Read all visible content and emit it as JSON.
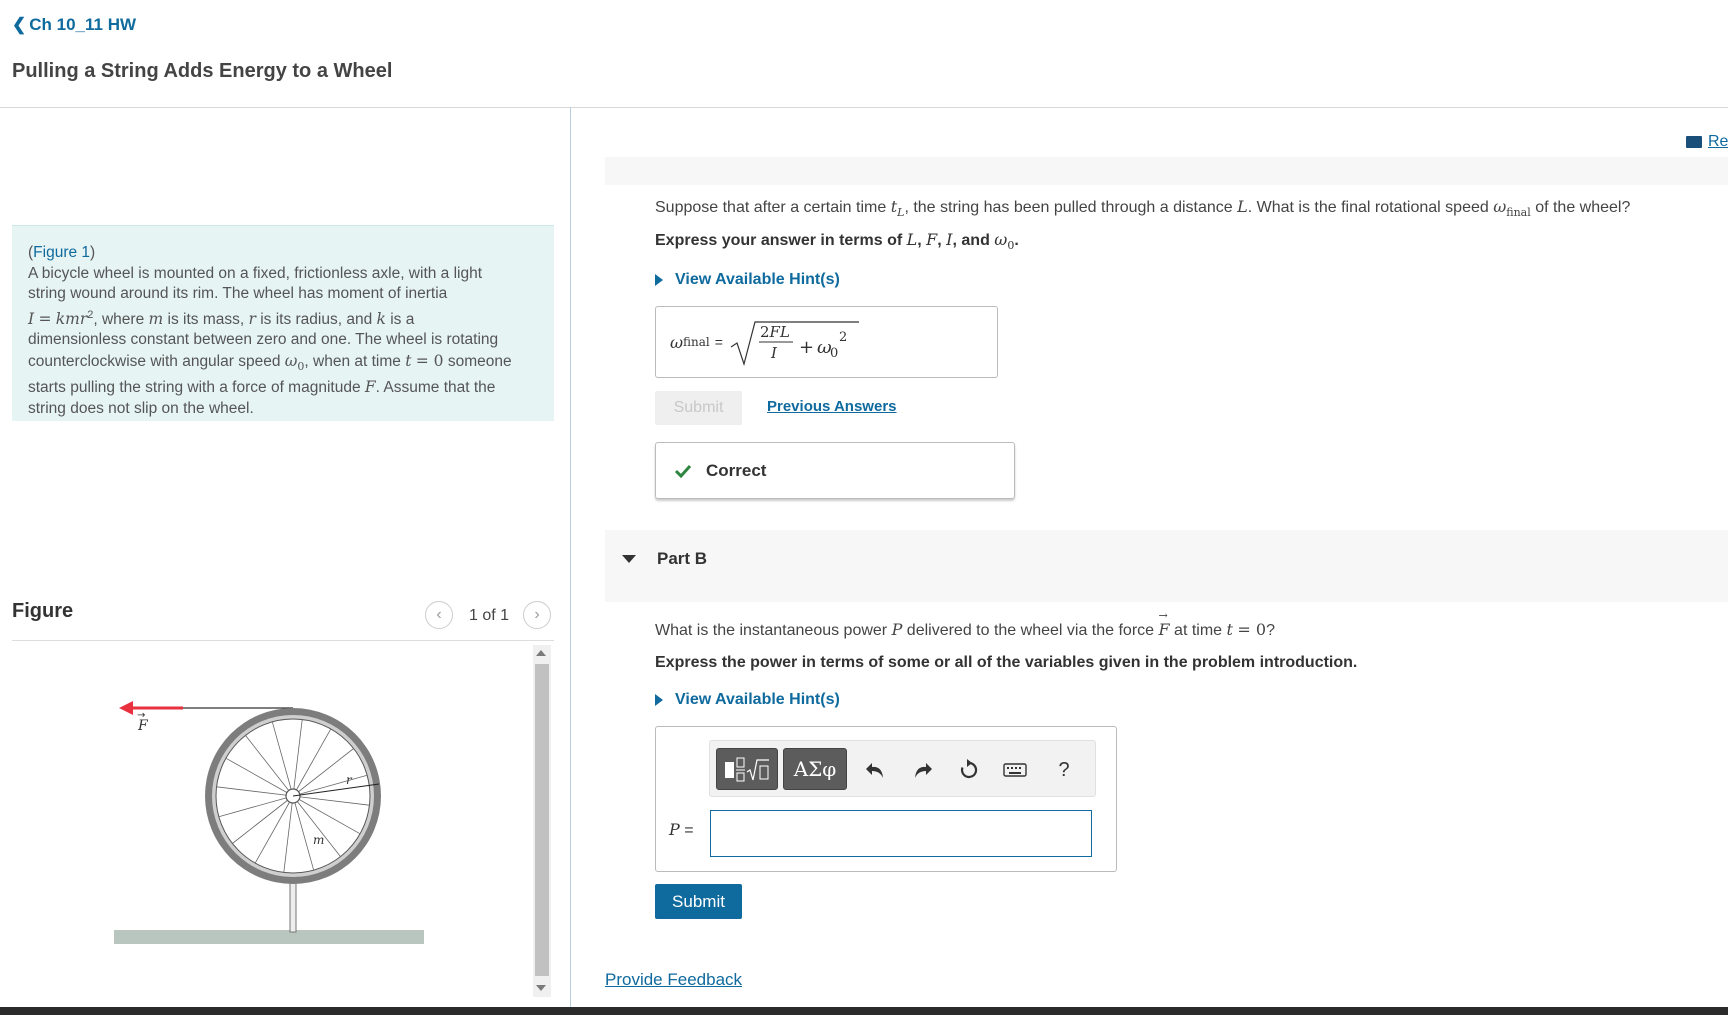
{
  "header": {
    "back_label": "Ch 10_11 HW",
    "page_title": "Pulling a String Adds Energy to a Wheel"
  },
  "intro": {
    "figure_link": "Figure 1",
    "line1": "A bicycle wheel is mounted on a fixed, frictionless axle, with a light",
    "line2": "string wound around its rim. The wheel has moment of inertia"
  },
  "figure": {
    "heading": "Figure",
    "pager": "1 of 1",
    "labels": {
      "force": "F",
      "radius": "r",
      "mass": "m"
    }
  },
  "review": {
    "label": "Re"
  },
  "part_a": {
    "express": "Express your answer in terms of",
    "hints": "View Available Hint(s)",
    "answer_lhs": "final",
    "submit": "Submit",
    "previous_answers": "Previous Answers",
    "status": "Correct"
  },
  "part_b": {
    "label": "Part B",
    "express": "Express the power in terms of some or all of the variables given in the problem introduction.",
    "hints": "View Available Hint(s)",
    "variable": "P",
    "submit": "Submit"
  },
  "feedback": {
    "label": "Provide Feedback"
  },
  "icons": {
    "back": "chevron-left-icon",
    "review": "book-icon",
    "hint": "triangle-right-icon",
    "correct": "check-icon",
    "collapse": "triangle-down-icon",
    "undo": "undo-icon",
    "redo": "redo-icon",
    "reset": "reset-icon",
    "keyboard": "keyboard-icon",
    "help": "help-icon"
  },
  "colors": {
    "link": "#0f6a9e",
    "intro_bg": "#e6f4f4",
    "correct_check": "#2e8540",
    "force_arrow": "#e8303f"
  }
}
